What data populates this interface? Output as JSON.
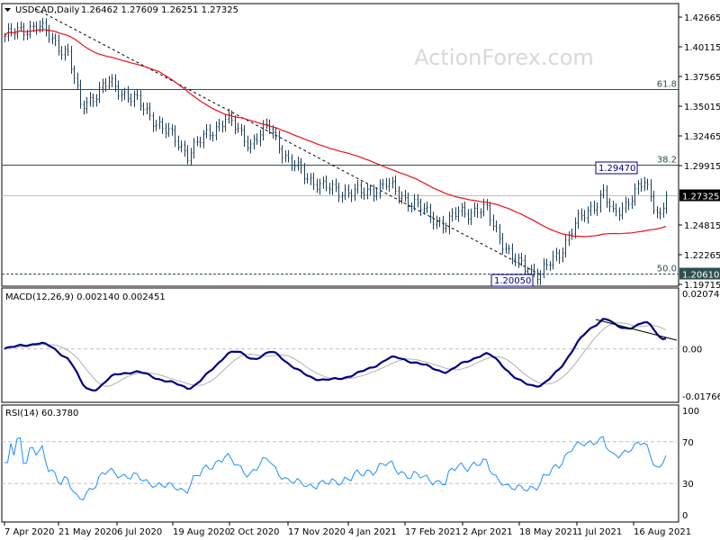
{
  "header": {
    "symbol": "USDCAD,Daily",
    "ohlc": "1.26462 1.27609 1.26251 1.27325"
  },
  "watermark": "ActionForex.com",
  "colors": {
    "bars": "#1e3f5a",
    "ma": "#e8101a",
    "macd": "#000080",
    "signal": "#b0b0b0",
    "rsi": "#1e90ff",
    "current_label_bg": "#000000",
    "fib_label_bg": "#2f4f4f",
    "callout": "#000080"
  },
  "chart_data": {
    "type": "line",
    "title": "USDCAD Daily",
    "price_axis": {
      "ticks": [
        "1.42665",
        "1.40115",
        "1.37565",
        "1.35015",
        "1.32465",
        "1.29915",
        "1.27325",
        "1.24815",
        "1.22265",
        "1.20610",
        "1.19715"
      ],
      "ylim": [
        1.19715,
        1.42665
      ]
    },
    "current_price": "1.27325",
    "fib_levels": [
      {
        "label": "61.8",
        "price": 1.3648
      },
      {
        "label": "38.2",
        "price": 1.2996
      },
      {
        "label": "50.0",
        "price": 1.2061,
        "value_label": "1.20610"
      }
    ],
    "callouts": [
      {
        "label": "1.29470",
        "price": 1.2947
      },
      {
        "label": "1.20050",
        "price": 1.2005
      }
    ],
    "close_keypoints": [
      [
        0,
        1.41
      ],
      [
        10,
        1.42
      ],
      [
        20,
        1.395
      ],
      [
        24,
        1.35
      ],
      [
        33,
        1.37
      ],
      [
        41,
        1.356
      ],
      [
        58,
        1.31
      ],
      [
        70,
        1.34
      ],
      [
        78,
        1.318
      ],
      [
        84,
        1.333
      ],
      [
        90,
        1.302
      ],
      [
        101,
        1.28
      ],
      [
        113,
        1.275
      ],
      [
        121,
        1.283
      ],
      [
        133,
        1.26
      ],
      [
        140,
        1.247
      ],
      [
        144,
        1.26
      ],
      [
        153,
        1.26
      ],
      [
        161,
        1.218
      ],
      [
        170,
        1.205
      ],
      [
        176,
        1.225
      ],
      [
        181,
        1.248
      ],
      [
        190,
        1.275
      ],
      [
        193,
        1.256
      ],
      [
        203,
        1.284
      ],
      [
        208,
        1.256
      ],
      [
        210,
        1.273
      ]
    ],
    "ma_period": 50,
    "macd": {
      "label": "MACD(12,26,9) 0.002140 0.002451",
      "ticks": [
        "0.020747",
        "0.00",
        "-0.017661"
      ],
      "ylim": [
        -0.017661,
        0.020747
      ]
    },
    "rsi": {
      "label": "RSI(14) 60.3780",
      "ticks": [
        "100",
        "70",
        "30",
        "0"
      ],
      "ylim": [
        0,
        100
      ]
    },
    "x_labels": [
      "7 Apr 2020",
      "21 May 2020",
      "6 Jul 2020",
      "19 Aug 2020",
      "2 Oct 2020",
      "17 Nov 2020",
      "4 Jan 2021",
      "17 Feb 2021",
      "2 Apr 2021",
      "18 May 2021",
      "1 Jul 2021",
      "16 Aug 2021"
    ]
  }
}
